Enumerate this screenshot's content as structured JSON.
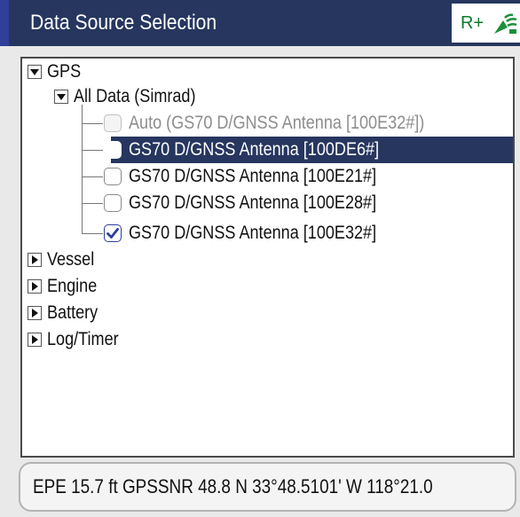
{
  "title": "Data Source Selection",
  "title_badge": {
    "label": "R+",
    "icon": "signal-antenna-icon"
  },
  "tree": {
    "gps": {
      "label": "GPS",
      "expanded": true
    },
    "all_data": {
      "label": "All Data (Simrad)",
      "expanded": true
    },
    "sources": [
      {
        "label": "Auto (GS70 D/GNSS Antenna [100E32#])",
        "checked": false,
        "disabled": true,
        "selected": false
      },
      {
        "label": "GS70 D/GNSS Antenna [100DE6#]",
        "checked": false,
        "disabled": false,
        "selected": true
      },
      {
        "label": "GS70 D/GNSS Antenna [100E21#]",
        "checked": false,
        "disabled": false,
        "selected": false
      },
      {
        "label": "GS70 D/GNSS Antenna [100E28#]",
        "checked": false,
        "disabled": false,
        "selected": false
      },
      {
        "label": "GS70 D/GNSS Antenna [100E32#]",
        "checked": true,
        "disabled": false,
        "selected": false
      }
    ],
    "categories": [
      {
        "label": "Vessel",
        "expanded": false
      },
      {
        "label": "Engine",
        "expanded": false
      },
      {
        "label": "Battery",
        "expanded": false
      },
      {
        "label": "Log/Timer",
        "expanded": false
      }
    ]
  },
  "status": {
    "text": "EPE 15.7 ft   GPSSNR 48.8   N  33°48.5101' W 118°21.0"
  },
  "colors": {
    "title_bar": "#26365f",
    "selection": "#26365f",
    "check_accent": "#2f3f9a",
    "badge_green": "#0a7a2a"
  }
}
